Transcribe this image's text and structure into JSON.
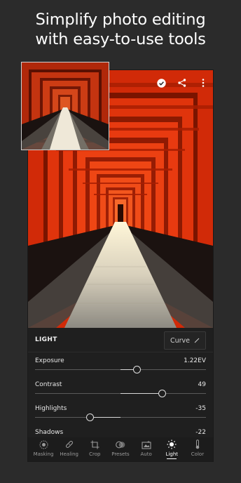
{
  "headline": {
    "line1": "Simplify photo editing",
    "line2": "with easy-to-use tools"
  },
  "top_icons": [
    "check-circle-icon",
    "share-icon",
    "more-vertical-icon"
  ],
  "panel": {
    "title": "LIGHT",
    "curve_label": "Curve",
    "sliders": [
      {
        "label": "Exposure",
        "value": "1.22EV",
        "fraction": 0.6,
        "center": 0.5
      },
      {
        "label": "Contrast",
        "value": "49",
        "fraction": 0.745,
        "center": 0.5
      },
      {
        "label": "Highlights",
        "value": "-35",
        "fraction": 0.325,
        "center": 0.5
      },
      {
        "label": "Shadows",
        "value": "-22",
        "fraction": 0.39,
        "center": 0.5
      }
    ]
  },
  "toolbar": {
    "items": [
      {
        "label": "Masking",
        "icon": "masking-icon"
      },
      {
        "label": "Healing",
        "icon": "bandage-icon"
      },
      {
        "label": "Crop",
        "icon": "crop-icon"
      },
      {
        "label": "Presets",
        "icon": "presets-icon"
      },
      {
        "label": "Auto",
        "icon": "auto-icon"
      },
      {
        "label": "Light",
        "icon": "sun-icon",
        "active": true
      },
      {
        "label": "Color",
        "icon": "thermometer-icon"
      }
    ]
  },
  "colors": {
    "accent": "#ffffff",
    "torii_red": "#d9300c",
    "background": "#2b2b2b"
  }
}
